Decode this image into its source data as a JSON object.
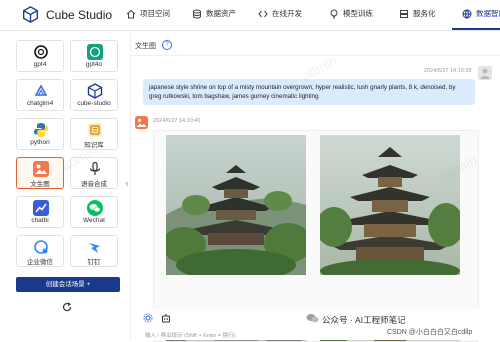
{
  "app": {
    "name": "Cube Studio"
  },
  "nav": [
    {
      "label": "项目空间",
      "icon": "home-icon"
    },
    {
      "label": "数据资产",
      "icon": "database-icon"
    },
    {
      "label": "在线开发",
      "icon": "code-icon"
    },
    {
      "label": "模型训练",
      "icon": "bulb-icon"
    },
    {
      "label": "服务化",
      "icon": "server-icon"
    },
    {
      "label": "数据智能",
      "icon": "globe-icon",
      "active": true
    }
  ],
  "sidebar": {
    "tiles": [
      {
        "label": "gpt4",
        "icon": "openai-icon"
      },
      {
        "label": "gpt4o",
        "icon": "openai-icon"
      },
      {
        "label": "chatglm4",
        "icon": "chatglm-icon"
      },
      {
        "label": "cube-studio",
        "icon": "cube-icon"
      },
      {
        "label": "python",
        "icon": "python-icon"
      },
      {
        "label": "知识库",
        "icon": "knowledge-icon"
      },
      {
        "label": "文生图",
        "icon": "text-to-image-icon",
        "selected": true
      },
      {
        "label": "语音合成",
        "icon": "speech-icon"
      },
      {
        "label": "chatbi",
        "icon": "chart-icon"
      },
      {
        "label": "Wechat",
        "icon": "wechat-icon"
      },
      {
        "label": "企业微信",
        "icon": "wecom-icon"
      },
      {
        "label": "钉钉",
        "icon": "dingtalk-icon"
      }
    ],
    "create_button": "创建会话场景 +"
  },
  "chat": {
    "title": "文生图",
    "help": "?",
    "user_time": "2024/6/27 14:10:28",
    "prompt": "japanese style shrine on top of a misty mountain overgrown, hyper realistic, lush gnarly plants, 8 k, denoised, by greg rutkowski, tom bagshaw, james gurney cinematic lighting",
    "bot_time": "2024/6/27 14:10:40",
    "input_placeholder": "输入 / 唤出提示 (Shift + Enter = 换行)"
  },
  "watermarks": {
    "wechat": "公众号 · AI工程师笔记",
    "csdn": "CSDN @小白白白又白cdllp",
    "app": "admin"
  },
  "colors": {
    "brand": "#1a3a8f",
    "selected": "#e0622a",
    "bubble": "#dbeafd"
  }
}
